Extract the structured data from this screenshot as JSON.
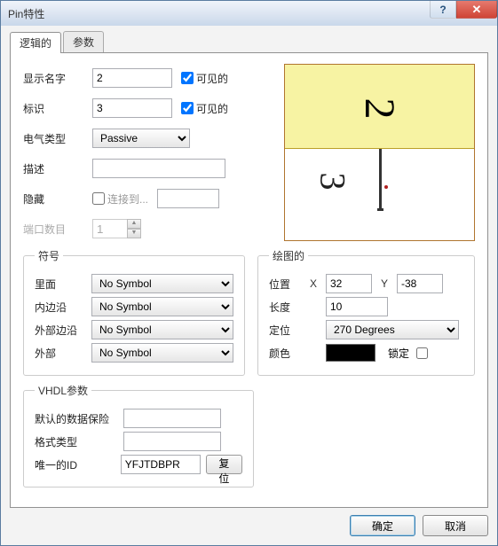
{
  "window": {
    "title": "Pin特性"
  },
  "tabs": {
    "logical": "逻辑的",
    "params": "参数"
  },
  "main": {
    "display_name_label": "显示名字",
    "display_name_value": "2",
    "visible_label": "可见的",
    "designator_label": "标识",
    "designator_value": "3",
    "electrical_type_label": "电气类型",
    "electrical_type_value": "Passive",
    "description_label": "描述",
    "description_value": "",
    "hidden_label": "隐藏",
    "connect_to_label": "连接到...",
    "connect_to_value": "",
    "port_count_label": "端口数目",
    "port_count_value": "1"
  },
  "preview": {
    "name_text": "2",
    "number_text": "3"
  },
  "symbols": {
    "legend": "符号",
    "inside_label": "里面",
    "inside_value": "No Symbol",
    "inside_edge_label": "内边沿",
    "inside_edge_value": "No Symbol",
    "outside_edge_label": "外部边沿",
    "outside_edge_value": "No Symbol",
    "outside_label": "外部",
    "outside_value": "No Symbol"
  },
  "graphics": {
    "legend": "绘图的",
    "position_label": "位置",
    "x_label": "X",
    "x_value": "32",
    "y_label": "Y",
    "y_value": "-38",
    "length_label": "长度",
    "length_value": "10",
    "orientation_label": "定位",
    "orientation_value": "270 Degrees",
    "color_label": "颜色",
    "color_value": "#000000",
    "lock_label": "锁定"
  },
  "vhdl": {
    "legend": "VHDL参数",
    "default_label": "默认的数据保险",
    "default_value": "",
    "format_label": "格式类型",
    "format_value": "",
    "unique_id_label": "唯一的ID",
    "unique_id_value": "YFJTDBPR",
    "reset_label": "复位"
  },
  "buttons": {
    "ok": "确定",
    "cancel": "取消"
  }
}
